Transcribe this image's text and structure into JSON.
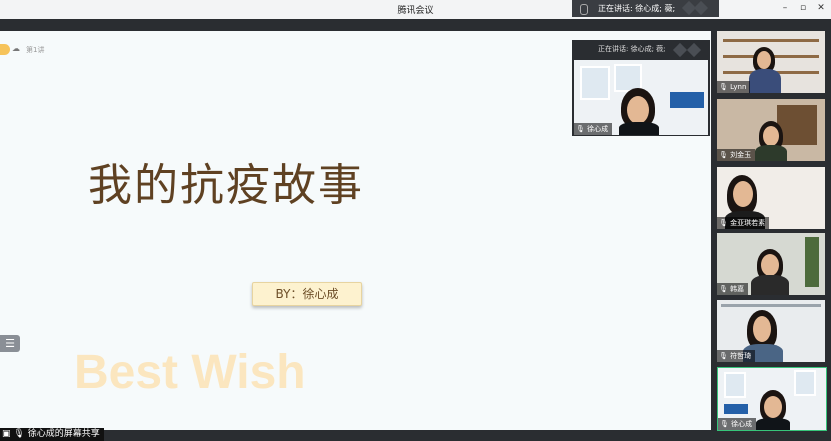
{
  "window": {
    "title": "腾讯会议"
  },
  "speaking": {
    "top": "正在讲话: 徐心成; 薇;",
    "panel": "正在讲话: 徐心成; 薇;"
  },
  "slide": {
    "tag": "第1讲",
    "title": "我的抗疫故事",
    "by": "BY：徐心成",
    "watermark": "Best Wish"
  },
  "share_label": "徐心成的屏幕共享",
  "participants": [
    {
      "name": "徐心成"
    },
    {
      "name": "Lynn"
    },
    {
      "name": "刘金玉"
    },
    {
      "name": "金亚琪若素"
    },
    {
      "name": "韩嘉"
    },
    {
      "name": "符哲琦"
    },
    {
      "name": "徐心成"
    }
  ],
  "icons": {
    "minimize": "minimize-icon",
    "maximize": "maximize-icon",
    "close": "close-icon",
    "mic": "mic-icon",
    "list": "list-icon",
    "screen-share": "screen-share-icon"
  },
  "colors": {
    "accent": "#f6c35a",
    "title": "#5f4122",
    "watermark": "#fbe6bf"
  }
}
